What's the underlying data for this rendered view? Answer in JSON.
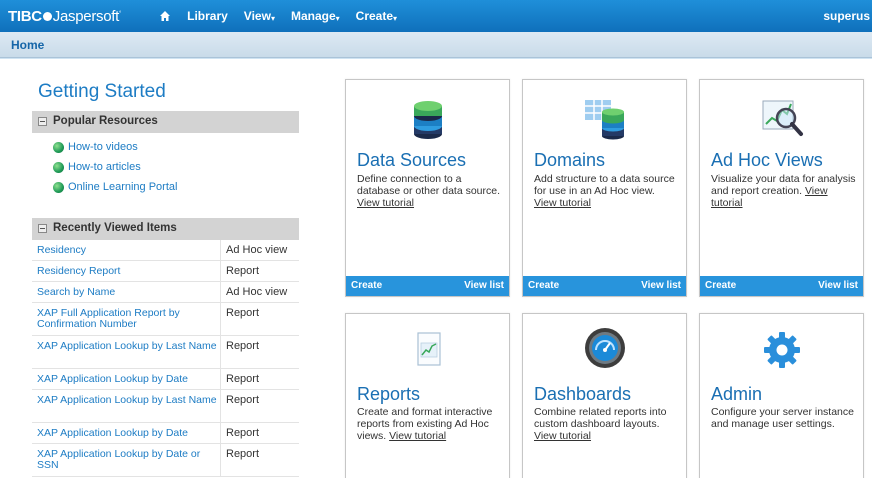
{
  "topbar": {
    "logo_tibco": "TIBC",
    "logo_jasper": "Jaspersoft",
    "nav": [
      {
        "label": "Library"
      },
      {
        "label": "View",
        "caret": "▾"
      },
      {
        "label": "Manage",
        "caret": "▾"
      },
      {
        "label": "Create",
        "caret": "▾"
      }
    ],
    "user": "superus"
  },
  "breadcrumb": {
    "current": "Home"
  },
  "getting_started": {
    "title": "Getting Started",
    "popular": {
      "heading": "Popular Resources",
      "links": [
        "How-to videos",
        "How-to articles",
        "Online Learning Portal"
      ]
    },
    "recent": {
      "heading": "Recently Viewed Items",
      "items": [
        {
          "name": "Residency",
          "type": "Ad Hoc view"
        },
        {
          "name": "Residency Report",
          "type": "Report"
        },
        {
          "name": "Search by Name",
          "type": "Ad Hoc view"
        },
        {
          "name": "XAP Full Application Report by Confirmation Number",
          "type": "Report"
        },
        {
          "name": "XAP Application Lookup by Last Name",
          "type": "Report"
        },
        {
          "name": "XAP Application Lookup by Date",
          "type": "Report"
        },
        {
          "name": "XAP Application Lookup by Last Name",
          "type": "Report"
        },
        {
          "name": "XAP Application Lookup by Date",
          "type": "Report"
        },
        {
          "name": "XAP Application Lookup by Date or SSN",
          "type": "Report"
        }
      ]
    }
  },
  "cards": [
    {
      "title": "Data Sources",
      "desc": "Define connection to a database or other data source.",
      "tutorial": "View tutorial",
      "create": "Create",
      "view_list": "View list",
      "icon": "database-icon"
    },
    {
      "title": "Domains",
      "desc": "Add structure to a data source for use in an Ad Hoc view.",
      "tutorial": "View tutorial",
      "create": "Create",
      "view_list": "View list",
      "icon": "domain-icon"
    },
    {
      "title": "Ad Hoc Views",
      "desc": "Visualize your data for analysis and report creation.",
      "tutorial": "View tutorial",
      "create": "Create",
      "view_list": "View list",
      "icon": "adhoc-chart-icon"
    },
    {
      "title": "Reports",
      "desc": "Create and format interactive reports from existing Ad Hoc views.",
      "tutorial": "View tutorial",
      "icon": "report-icon"
    },
    {
      "title": "Dashboards",
      "desc": "Combine related reports into custom dashboard layouts.",
      "tutorial": "View tutorial",
      "icon": "gauge-icon"
    },
    {
      "title": "Admin",
      "desc": "Configure your server instance and manage user settings.",
      "icon": "gear-icon"
    }
  ],
  "colors": {
    "accent": "#1d7cc4",
    "topbar": "#1480cc",
    "card_footer": "#2894dc"
  }
}
